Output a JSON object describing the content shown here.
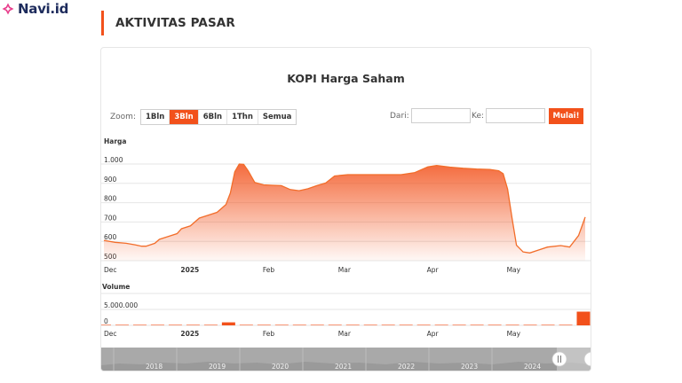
{
  "brand": {
    "name": "Navi.id",
    "accent": "#f2511b",
    "icon": "diamond-sparkle-icon"
  },
  "section": {
    "title": "AKTIVITAS PASAR"
  },
  "toolbar": {
    "zoom_label": "Zoom:",
    "zoom_options": [
      "1Bln",
      "3Bln",
      "6Bln",
      "1Thn",
      "Semua"
    ],
    "zoom_selected": "3Bln",
    "from_label": "Dari:",
    "from_value": "",
    "to_label": "Ke:",
    "to_value": "",
    "go_label": "Mulai!"
  },
  "chart_data": [
    {
      "type": "area",
      "title": "KOPI Harga Saham",
      "ylabel": "Harga",
      "xlabel": "",
      "ylim": [
        500,
        1000
      ],
      "y_ticks": [
        "1.000",
        "900",
        "800",
        "700",
        "600",
        "500"
      ],
      "x_ticks": [
        "Dec",
        "2025",
        "Feb",
        "Mar",
        "Apr",
        "May"
      ],
      "x_tick_bold": [
        false,
        true,
        false,
        false,
        false,
        false
      ],
      "grid": true,
      "color": "#f2511b",
      "series": [
        {
          "values": [
            [
              0,
              605
            ],
            [
              5,
              595
            ],
            [
              10,
              590
            ],
            [
              14,
              582
            ],
            [
              17,
              575
            ],
            [
              19,
              575
            ],
            [
              23,
              590
            ],
            [
              25,
              610
            ],
            [
              29,
              625
            ],
            [
              33,
              640
            ],
            [
              35,
              665
            ],
            [
              39,
              680
            ],
            [
              43,
              720
            ],
            [
              47,
              735
            ],
            [
              51,
              750
            ],
            [
              55,
              790
            ],
            [
              57,
              850
            ],
            [
              59,
              960
            ],
            [
              61,
              1000
            ],
            [
              63,
              998
            ],
            [
              65,
              965
            ],
            [
              68,
              905
            ],
            [
              72,
              892
            ],
            [
              76,
              890
            ],
            [
              80,
              888
            ],
            [
              84,
              868
            ],
            [
              88,
              862
            ],
            [
              92,
              872
            ],
            [
              96,
              888
            ],
            [
              100,
              902
            ],
            [
              104,
              938
            ],
            [
              110,
              945
            ],
            [
              118,
              945
            ],
            [
              126,
              945
            ],
            [
              134,
              945
            ],
            [
              140,
              955
            ],
            [
              146,
              985
            ],
            [
              150,
              992
            ],
            [
              156,
              984
            ],
            [
              162,
              978
            ],
            [
              168,
              974
            ],
            [
              174,
              972
            ],
            [
              178,
              965
            ],
            [
              180,
              950
            ],
            [
              182,
              870
            ],
            [
              184,
              720
            ],
            [
              186,
              580
            ],
            [
              189,
              545
            ],
            [
              192,
              540
            ],
            [
              196,
              555
            ],
            [
              200,
              570
            ],
            [
              206,
              578
            ],
            [
              210,
              570
            ],
            [
              214,
              630
            ],
            [
              217,
              725
            ]
          ]
        }
      ]
    },
    {
      "type": "bar",
      "title": "",
      "ylabel": "Volume",
      "xlabel": "",
      "ylim": [
        0,
        10000000
      ],
      "y_ticks": [
        "5.000.000",
        "0"
      ],
      "x_ticks": [
        "Dec",
        "2025",
        "Feb",
        "Mar",
        "Apr",
        "May"
      ],
      "x_tick_bold": [
        false,
        true,
        false,
        false,
        false,
        false
      ],
      "grid": true,
      "color": "#f2511b",
      "series": [
        {
          "values": [
            [
              0,
              60000
            ],
            [
              8,
              50000
            ],
            [
              16,
              60000
            ],
            [
              24,
              120000
            ],
            [
              32,
              110000
            ],
            [
              40,
              50000
            ],
            [
              48,
              60000
            ],
            [
              56,
              950000
            ],
            [
              64,
              80000
            ],
            [
              72,
              60000
            ],
            [
              80,
              50000
            ],
            [
              88,
              40000
            ],
            [
              96,
              50000
            ],
            [
              104,
              60000
            ],
            [
              112,
              50000
            ],
            [
              120,
              40000
            ],
            [
              128,
              60000
            ],
            [
              136,
              50000
            ],
            [
              144,
              70000
            ],
            [
              152,
              60000
            ],
            [
              160,
              50000
            ],
            [
              168,
              40000
            ],
            [
              176,
              60000
            ],
            [
              184,
              50000
            ],
            [
              192,
              120000
            ],
            [
              200,
              80000
            ],
            [
              208,
              60000
            ],
            [
              216,
              4300000
            ]
          ]
        }
      ]
    }
  ],
  "navigator": {
    "years": [
      "2018",
      "2019",
      "2020",
      "2021",
      "2022",
      "2023",
      "2024"
    ]
  }
}
